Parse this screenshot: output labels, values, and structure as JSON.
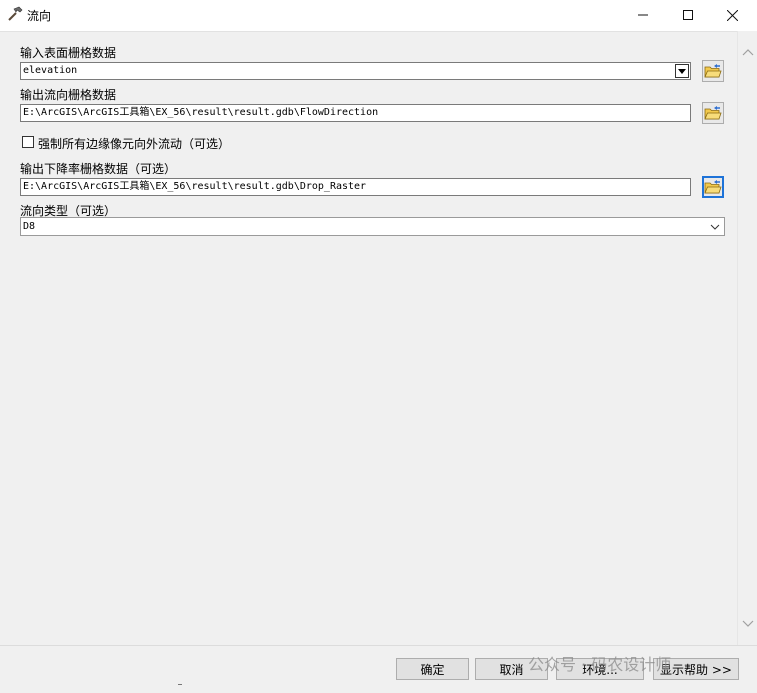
{
  "window": {
    "title": "流向"
  },
  "fields": {
    "input_surface": {
      "label": "输入表面栅格数据",
      "value": "elevation"
    },
    "output_flow": {
      "label": "输出流向栅格数据",
      "value": "E:\\ArcGIS\\ArcGIS工具箱\\EX_56\\result\\result.gdb\\FlowDirection"
    },
    "force_edge": {
      "label": "强制所有边缘像元向外流动（可选）",
      "checked": false
    },
    "output_drop": {
      "label": "输出下降率栅格数据（可选）",
      "value": "E:\\ArcGIS\\ArcGIS工具箱\\EX_56\\result\\result.gdb\\Drop_Raster"
    },
    "flow_type": {
      "label": "流向类型（可选）",
      "value": "D8"
    }
  },
  "buttons": {
    "ok": "确定",
    "cancel": "取消",
    "env": "环境...",
    "help": "显示帮助 >>"
  },
  "watermark": "公众号 · 码农设计师"
}
